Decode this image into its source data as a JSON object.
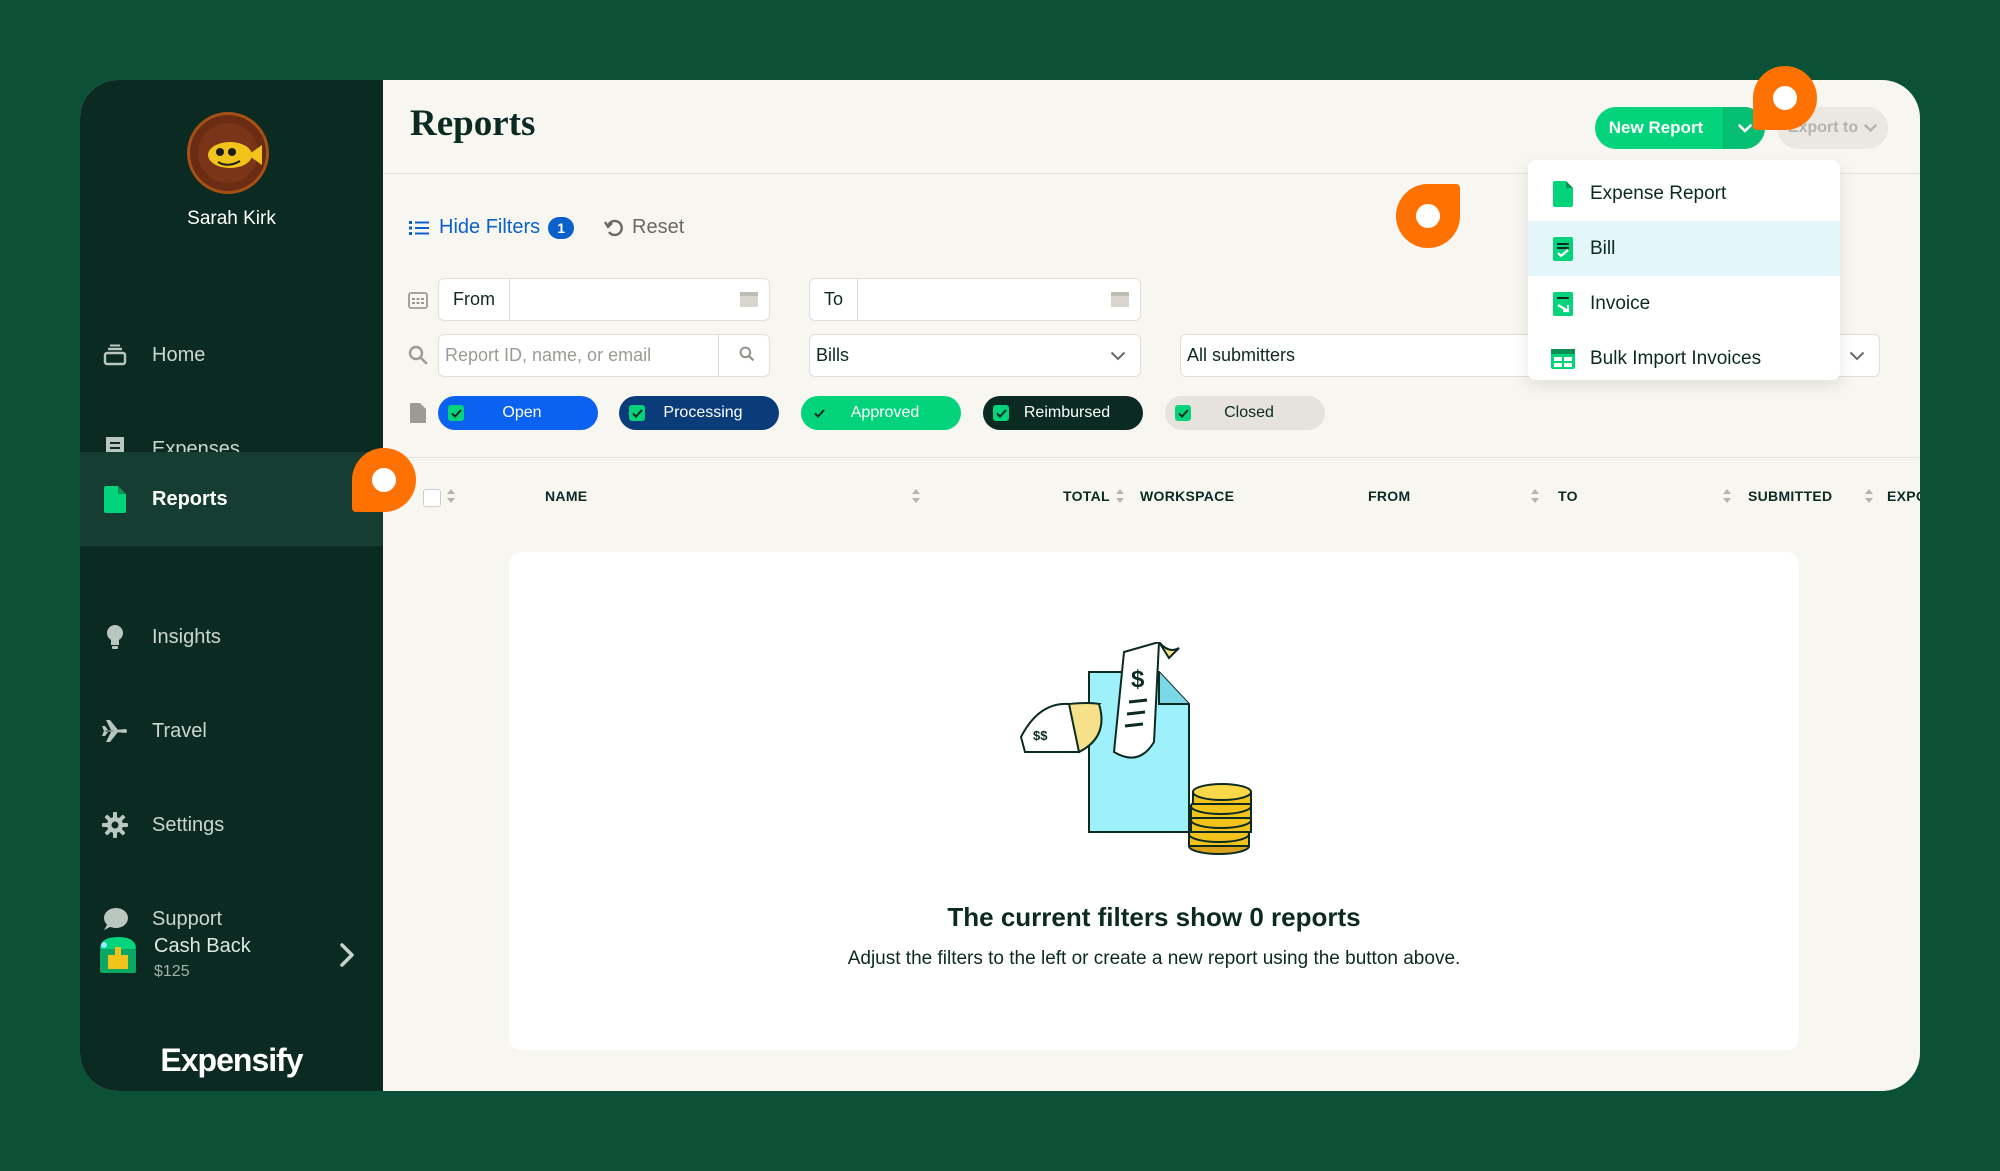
{
  "user": {
    "name": "Sarah Kirk"
  },
  "sidebar": {
    "items": [
      {
        "label": "Home",
        "icon": "inbox-icon"
      },
      {
        "label": "Expenses",
        "icon": "receipt-icon"
      },
      {
        "label": "Reports",
        "icon": "document-icon",
        "active": true
      },
      {
        "label": "Insights",
        "icon": "lightbulb-icon"
      },
      {
        "label": "Travel",
        "icon": "plane-icon"
      },
      {
        "label": "Settings",
        "icon": "gear-icon"
      },
      {
        "label": "Support",
        "icon": "chat-bubble-icon"
      }
    ],
    "cashback": {
      "title": "Cash Back",
      "amount": "$125"
    },
    "brand": "Expensify"
  },
  "header": {
    "title": "Reports",
    "new_report": "New Report",
    "export": "Export to"
  },
  "filters": {
    "hide_filters": "Hide Filters",
    "filter_count": "1",
    "reset": "Reset",
    "from_label": "From",
    "to_label": "To",
    "search_placeholder": "Report ID, name, or email",
    "type_value": "Bills",
    "submitters_value": "All submitters",
    "statuses": [
      "Open",
      "Processing",
      "Approved",
      "Reimbursed",
      "Closed"
    ]
  },
  "table": {
    "columns": [
      "NAME",
      "TOTAL",
      "WORKSPACE",
      "FROM",
      "TO",
      "SUBMITTED",
      "EXPORTED"
    ]
  },
  "empty_state": {
    "title": "The current filters show 0 reports",
    "subtitle": "Adjust the filters to the left or create a new report using the button above."
  },
  "new_report_menu": {
    "items": [
      {
        "label": "Expense Report",
        "icon": "document-icon"
      },
      {
        "label": "Bill",
        "icon": "bill-icon",
        "highlighted": true
      },
      {
        "label": "Invoice",
        "icon": "invoice-icon"
      },
      {
        "label": "Bulk Import Invoices",
        "icon": "table-grid-icon"
      }
    ]
  },
  "colors": {
    "accent_green": "#03d47c",
    "sidebar_bg": "#0b2a22",
    "frame_bg": "#0a5138",
    "hotspot_orange": "#ff7101",
    "link_blue": "#0b61c9"
  }
}
